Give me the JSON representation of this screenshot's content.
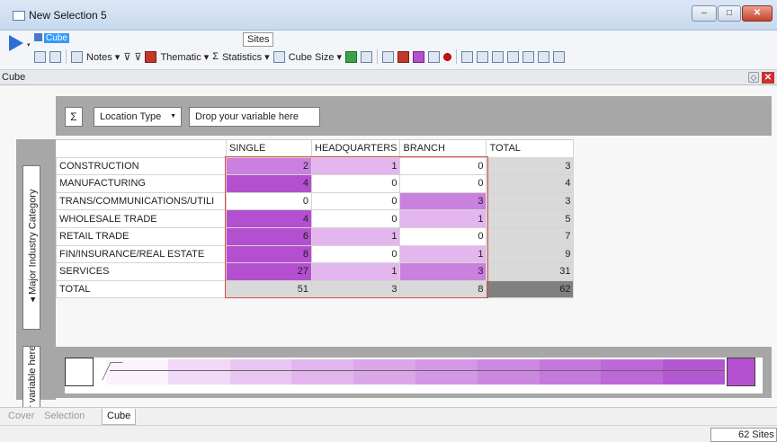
{
  "window": {
    "title": "New Selection 5",
    "minimize": "–",
    "maximize": "□",
    "close": "✕"
  },
  "toolbar": {
    "cube_name": "Cube",
    "sites_tag": "Sites",
    "notes": "Notes ▾",
    "thematic": "Thematic ▾",
    "sigma": "Σ",
    "statistics": "Statistics ▾",
    "cube_size": "Cube Size ▾"
  },
  "panel": {
    "title": "Cube"
  },
  "drop_bar": {
    "sigma": "Σ",
    "location_type": "Location Type",
    "drop_variable": "Drop your variable here"
  },
  "left_strip": {
    "industry_label": "◂ Major Industry Category",
    "drop_label": "Drop your variable here"
  },
  "grid": {
    "columns": [
      "SINGLE",
      "HEADQUARTERS",
      "BRANCH",
      "TOTAL"
    ],
    "rows": [
      {
        "label": "CONSTRUCTION",
        "values": [
          "2",
          "1",
          "0",
          "3"
        ]
      },
      {
        "label": "MANUFACTURING",
        "values": [
          "4",
          "0",
          "0",
          "4"
        ]
      },
      {
        "label": "TRANS/COMMUNICATIONS/UTILI",
        "values": [
          "0",
          "0",
          "3",
          "3"
        ]
      },
      {
        "label": "WHOLESALE TRADE",
        "values": [
          "4",
          "0",
          "1",
          "5"
        ]
      },
      {
        "label": "RETAIL TRADE",
        "values": [
          "6",
          "1",
          "0",
          "7"
        ]
      },
      {
        "label": "FIN/INSURANCE/REAL ESTATE",
        "values": [
          "8",
          "0",
          "1",
          "9"
        ]
      },
      {
        "label": "SERVICES",
        "values": [
          "27",
          "1",
          "3",
          "31"
        ]
      }
    ],
    "total_row": {
      "label": "TOTAL",
      "values": [
        "51",
        "3",
        "8",
        "62"
      ]
    },
    "colors": {
      "zero": "#ffffff",
      "low": "#e3b6ee",
      "mid": "#c980de",
      "high": "#b44fd0",
      "total": "#d9d9d9",
      "grand": "#808080"
    }
  },
  "legend": {
    "ramp": [
      "#fbf2fd",
      "#f1d8f7",
      "#e9c6f1",
      "#e2b6ed",
      "#dba7e9",
      "#d497e5",
      "#cc87e0",
      "#c478dc",
      "#bc68d7",
      "#b458d2"
    ]
  },
  "sheet_tabs": [
    "Cover",
    "Selection",
    "Cube"
  ],
  "status": {
    "sites": "62 Sites"
  }
}
